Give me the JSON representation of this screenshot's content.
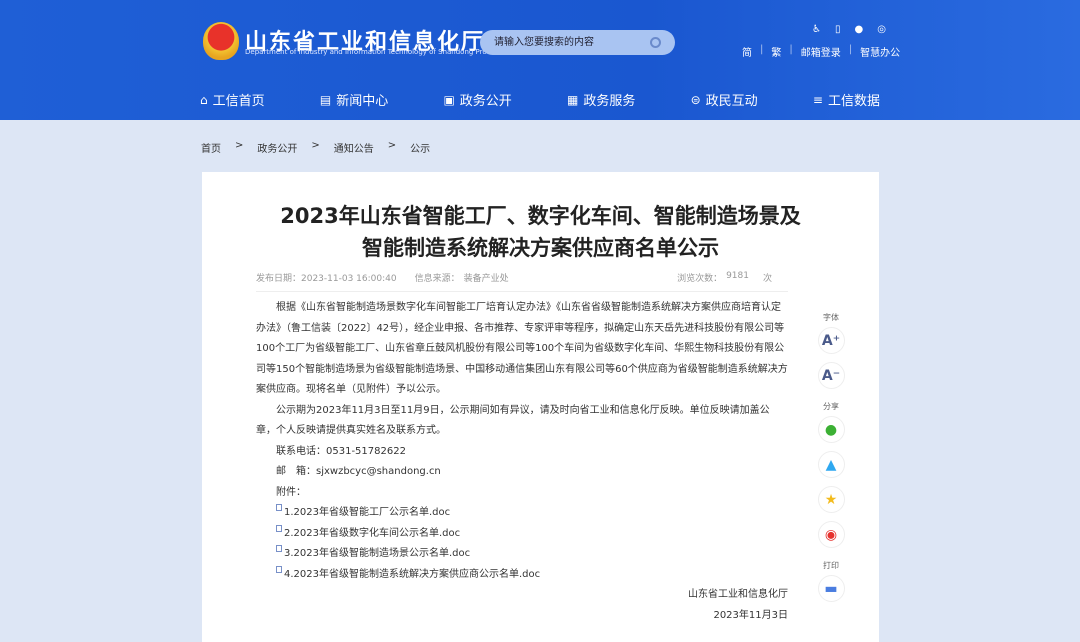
{
  "header": {
    "site_title": "山东省工业和信息化厅",
    "site_subtitle": "Department of Industry and Information Technology of Shandong Province",
    "search_placeholder": "请输入您要搜索的内容",
    "links": [
      "简",
      "繁",
      "邮箱登录",
      "智慧办公"
    ]
  },
  "nav": [
    {
      "label": "工信首页",
      "icon": "home-icon"
    },
    {
      "label": "新闻中心",
      "icon": "news-icon"
    },
    {
      "label": "政务公开",
      "icon": "monitor-icon"
    },
    {
      "label": "政务服务",
      "icon": "service-icon"
    },
    {
      "label": "政民互动",
      "icon": "chat-icon"
    },
    {
      "label": "工信数据",
      "icon": "database-icon"
    }
  ],
  "breadcrumb": [
    "首页",
    ">",
    "政务公开",
    ">",
    "通知公告",
    ">",
    "公示"
  ],
  "article": {
    "title_line1": "2023年山东省智能工厂、数字化车间、智能制造场景及",
    "title_line2": "智能制造系统解决方案供应商名单公示",
    "date": "发布日期：2023-11-03 16:00:40",
    "source_label": "信息来源：",
    "source": "装备产业处",
    "views_label": "浏览次数：",
    "views": "9181",
    "views_unit": "次",
    "para1": "根据《山东省智能制造场景数字化车间智能工厂培育认定办法》《山东省省级智能制造系统解决方案供应商培育认定办法》（鲁工信装〔2022〕42号），经企业申报、各市推荐、专家评审等程序，拟确定山东天岳先进科技股份有限公司等100个工厂为省级智能工厂、山东省章丘鼓风机股份有限公司等100个车间为省级数字化车间、华熙生物科技股份有限公司等150个智能制造场景为省级智能制造场景、中国移动通信集团山东有限公司等60个供应商为省级智能制造系统解决方案供应商。现将名单（见附件）予以公示。",
    "para2": "公示期为2023年11月3日至11月9日，公示期间如有异议，请及时向省工业和信息化厅反映。单位反映请加盖公章，个人反映请提供真实姓名及联系方式。",
    "phone": "联系电话：0531-51782622",
    "email": "邮　箱：sjxwzbcyc@shandong.cn",
    "attachments_label": "附件：",
    "attachments": [
      "1.2023年省级智能工厂公示名单.doc",
      "2.2023年省级数字化车间公示名单.doc",
      "3.2023年省级智能制造场景公示名单.doc",
      "4.2023年省级智能制造系统解决方案供应商公示名单.doc"
    ],
    "signer": "山东省工业和信息化厅",
    "sign_date": "2023年11月3日"
  },
  "side": {
    "font_label": "字体",
    "font_up": "A⁺",
    "font_down": "A⁻",
    "share_label": "分享",
    "print_label": "打印"
  },
  "colors": {
    "header": "#1f5fd6",
    "wechat": "#3cb034",
    "qq": "#2fa8f0",
    "qzone": "#f3bb1c",
    "weibo": "#e6322e",
    "print": "#4a7de0"
  }
}
